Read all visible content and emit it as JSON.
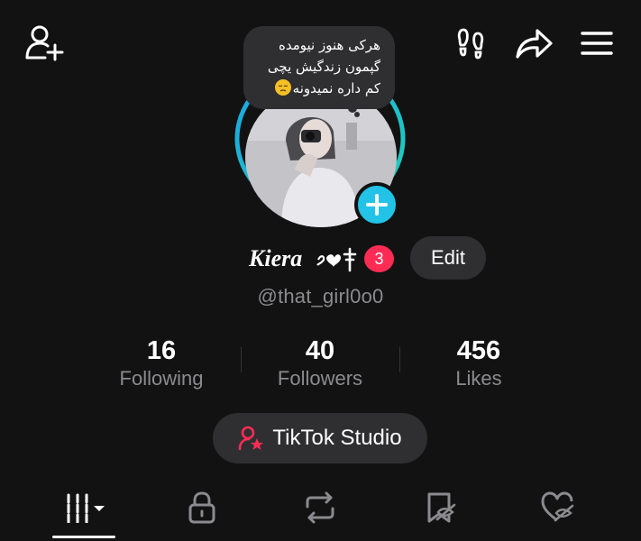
{
  "top_bar": {
    "add_friend_icon": "person-plus-icon",
    "footprint_icon": "footprints-icon",
    "share_icon": "share-arrow-icon",
    "menu_icon": "hamburger-menu-icon"
  },
  "note": {
    "lines": [
      "هرکی هنوز نیومده",
      "گپمون زندگیش یچی",
      "کم داره نمیدونه"
    ],
    "emoji": "😔"
  },
  "profile": {
    "display_name": "Kiera",
    "name_glyphs": "❥☦",
    "notification_count": "3",
    "edit_label": "Edit",
    "username": "@that_girl0o0"
  },
  "stats": [
    {
      "value": "16",
      "label": "Following"
    },
    {
      "value": "40",
      "label": "Followers"
    },
    {
      "value": "456",
      "label": "Likes"
    }
  ],
  "studio": {
    "label": "TikTok Studio",
    "icon": "person-star-icon"
  },
  "tabs": [
    {
      "icon": "videos-grid-icon",
      "selected": true
    },
    {
      "icon": "lock-icon",
      "selected": false
    },
    {
      "icon": "repost-icon",
      "selected": false
    },
    {
      "icon": "favorites-hidden-icon",
      "selected": false
    },
    {
      "icon": "liked-hidden-icon",
      "selected": false
    }
  ],
  "colors": {
    "background": "#121212",
    "accent_cyan": "#22c3e6",
    "badge_red": "#fe2c55",
    "button_gray": "#2f2f31",
    "secondary_text": "#8b8b8f"
  }
}
